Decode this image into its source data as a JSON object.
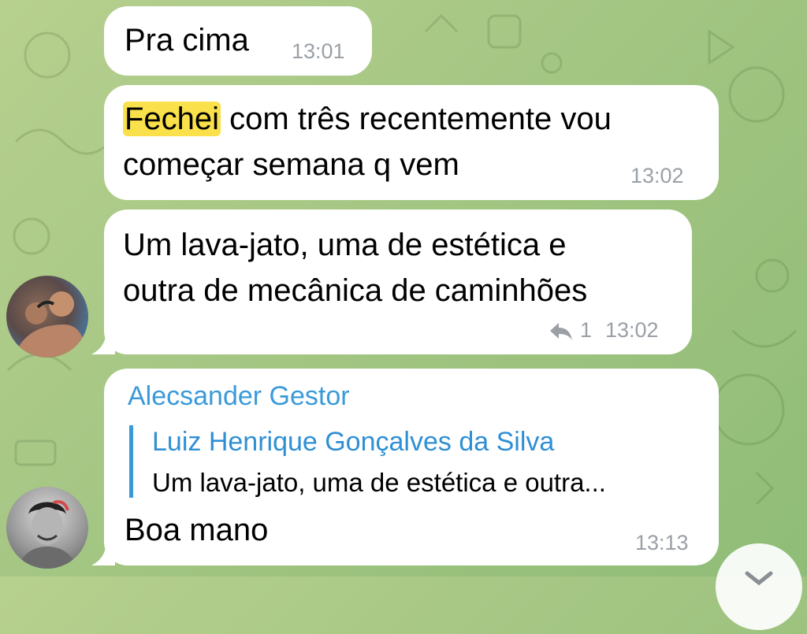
{
  "messages": [
    {
      "text": "Pra cima",
      "time": "13:01"
    },
    {
      "highlight": "Fechei",
      "text_rest": " com três recentemente vou\ncomeçar semana q vem",
      "time": "13:02"
    },
    {
      "text": "Um lava-jato, uma de estética e\noutra de mecânica de caminhões",
      "reply_count": "1",
      "time": "13:02"
    },
    {
      "sender": "Alecsander Gestor",
      "reply_to_name": "Luiz Henrique Gonçalves da Silva",
      "reply_to_text": "Um lava-jato, uma de estética e outra...",
      "text": "Boa mano",
      "time": "13:13"
    }
  ],
  "colors": {
    "accent": "#3a9ad9",
    "highlight": "#fae04a",
    "time": "#9aa0a6"
  },
  "icons": [
    "reply-arrow-icon",
    "chevron-down-icon"
  ]
}
